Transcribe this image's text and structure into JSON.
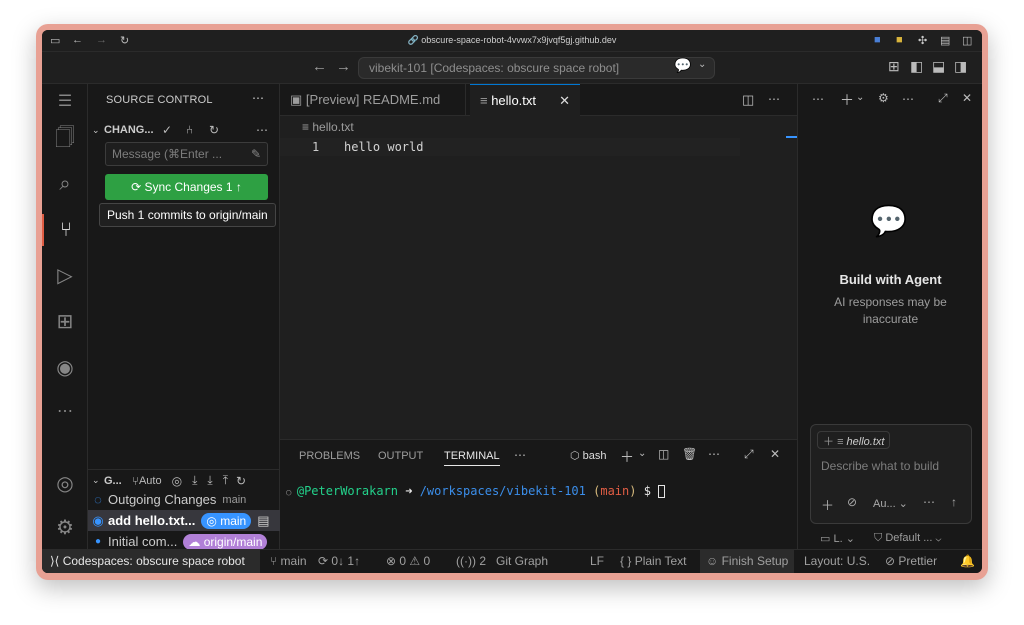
{
  "browser": {
    "url": "obscure-space-robot-4vvwx7x9jvqf5gj.github.dev"
  },
  "titlebar": {
    "command_center": "vibekit-101 [Codespaces: obscure space robot]"
  },
  "sidebar": {
    "title": "SOURCE CONTROL",
    "changes_section": "CHANG...",
    "message_placeholder": "Message (⌘Enter ...",
    "sync_button": "Sync Changes 1",
    "tooltip": "Push 1 commits to origin/main",
    "graph": {
      "section": "G...",
      "auto_label": "Auto",
      "rows": [
        {
          "title": "Outgoing Changes",
          "ref": "main"
        },
        {
          "title": "add hello.txt...",
          "badge": "main"
        },
        {
          "title": "Initial com...",
          "badge": "origin/main"
        }
      ]
    }
  },
  "editor": {
    "tabs": [
      {
        "label": "[Preview] README.md"
      },
      {
        "label": "hello.txt"
      }
    ],
    "breadcrumb": "hello.txt",
    "lines": [
      {
        "number": "1",
        "text": "hello world"
      }
    ]
  },
  "panel": {
    "tabs": [
      "PROBLEMS",
      "OUTPUT",
      "TERMINAL"
    ],
    "active_tab": "TERMINAL",
    "shell": "bash",
    "prompt": {
      "user": "@PeterWorakarn",
      "arrow": "➜",
      "path": "/workspaces/vibekit-101",
      "branch_open": "(",
      "branch": "main",
      "branch_close": ")",
      "symbol": "$"
    }
  },
  "chat": {
    "heading": "Build with Agent",
    "subtext": "AI responses may be inaccurate",
    "context_file": "hello.txt",
    "input_placeholder": "Describe what to build",
    "mode": "Au...",
    "footer_left": "L.",
    "footer_right": "Default ..."
  },
  "statusbar": {
    "remote": "Codespaces: obscure space robot",
    "branch": "main",
    "sync": "0↓ 1↑",
    "errors": "0",
    "warnings": "0",
    "ports": "2",
    "git_graph": "Git Graph",
    "eol": "LF",
    "language": "Plain Text",
    "finish_setup": "Finish Setup",
    "layout": "Layout: U.S.",
    "prettier": "Prettier"
  },
  "colors": {
    "accent_green": "#2ea043",
    "accent_blue": "#0078d4",
    "badge_blue": "#3794ff",
    "badge_purple": "#b180d7",
    "terminal_user": "#23d18b",
    "terminal_path": "#3b8eea",
    "terminal_branch": "#d7ba7d"
  }
}
